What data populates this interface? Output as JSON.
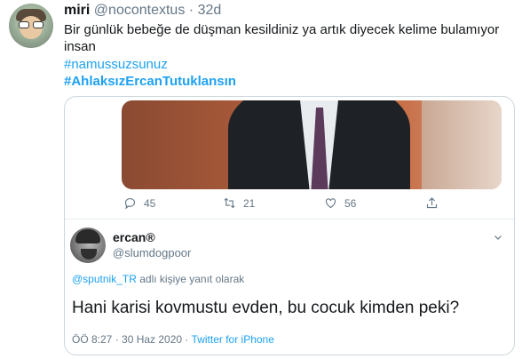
{
  "tweet": {
    "display_name": "miri",
    "handle": "@nocontextus",
    "separator": "·",
    "time": "32d",
    "text": "Bir günlük bebeğe de düşman kesildiniz ya artık diyecek kelime bulamıyor insan",
    "hashtags": [
      "#namussuzsunuz",
      "#AhlaksızErcanTutuklansın"
    ]
  },
  "embedded": {
    "action_counts": {
      "reply": "45",
      "retweet": "21",
      "like": "56"
    },
    "icons": [
      "reply-icon",
      "retweet-icon",
      "like-icon",
      "share-icon",
      "chevron-down-icon"
    ],
    "quoted": {
      "display_name": "ercan®",
      "handle": "@slumdogpoor",
      "reply_mention": "@sputnik_TR",
      "reply_suffix": "adlı kişiye yanıt olarak",
      "text": "Hani karisi kovmustu evden, bu cocuk kimden peki?",
      "timestamp": "ÖÖ 8:27 · 30 Haz 2020 ·",
      "source": "Twitter for iPhone"
    }
  },
  "colors": {
    "accent": "#1da1f2",
    "muted": "#657786",
    "text": "#14171a"
  }
}
